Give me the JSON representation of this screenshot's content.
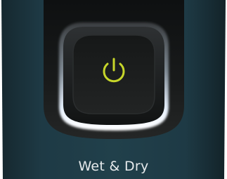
{
  "product": {
    "label": "Wet & Dry",
    "icon": "power-icon"
  },
  "colors": {
    "body": "#1d3540",
    "panel": "#141616",
    "button": "#1b1d1d",
    "ring_glow": "#e8f2ff",
    "power_icon": "#c7d62a",
    "label_text": "#e6eaec"
  }
}
